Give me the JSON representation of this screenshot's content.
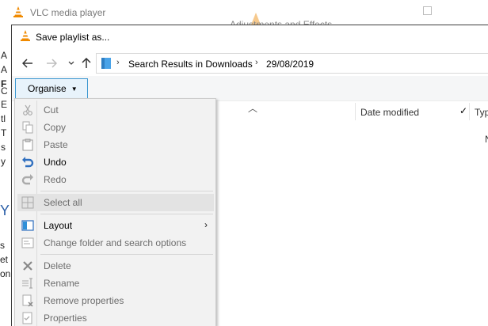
{
  "vlc": {
    "title": "VLC media player",
    "adjustments_title": "Adjustments and Effects"
  },
  "background_text": {
    "letters": [
      "A",
      "A",
      "F",
      "C",
      "E",
      "tl",
      "T",
      "s",
      "y"
    ],
    "big_y": "Y",
    "letters2": [
      "s",
      "et",
      "on"
    ]
  },
  "dialog": {
    "title": "Save playlist as...",
    "address": {
      "segments": [
        "Search Results in Downloads",
        "29/08/2019"
      ]
    },
    "organise_label": "Organise",
    "columns": {
      "date_modified": "Date modified",
      "type": "Typ"
    },
    "stray_letter": "N"
  },
  "menu": {
    "items": [
      {
        "label": "Cut",
        "icon": "scissors-icon",
        "disabled": true
      },
      {
        "label": "Copy",
        "icon": "copy-icon",
        "disabled": true
      },
      {
        "label": "Paste",
        "icon": "paste-icon",
        "disabled": true
      },
      {
        "label": "Undo",
        "icon": "undo-icon",
        "disabled": false
      },
      {
        "label": "Redo",
        "icon": "redo-icon",
        "disabled": true
      },
      {
        "label": "Select all",
        "icon": "select-all-icon",
        "disabled": true,
        "hover": true
      },
      {
        "label": "Layout",
        "icon": "layout-icon",
        "disabled": false,
        "submenu": true
      },
      {
        "label": "Change folder and search options",
        "icon": "folder-options-icon",
        "disabled": true
      },
      {
        "label": "Delete",
        "icon": "delete-icon",
        "disabled": true
      },
      {
        "label": "Rename",
        "icon": "rename-icon",
        "disabled": true
      },
      {
        "label": "Remove properties",
        "icon": "remove-properties-icon",
        "disabled": true
      },
      {
        "label": "Properties",
        "icon": "properties-icon",
        "disabled": true
      }
    ]
  },
  "colors": {
    "vlc_orange": "#f08a00",
    "accent_blue": "#3c98d1",
    "disabled_text": "#6d6d6d"
  }
}
